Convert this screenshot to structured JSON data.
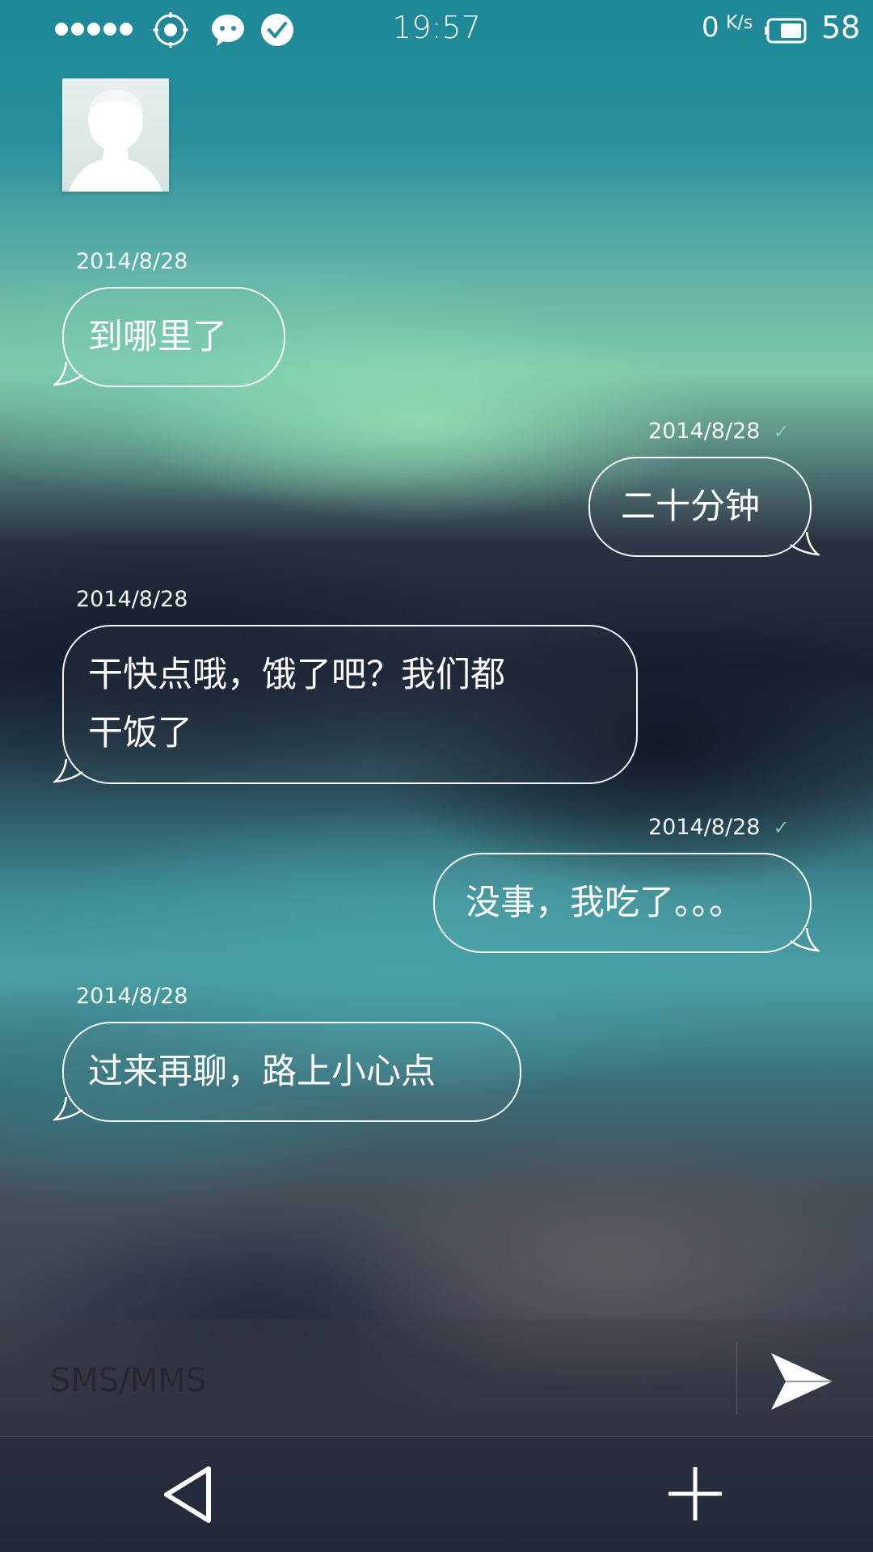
{
  "status_bar": {
    "time": "19:57",
    "net_speed": "0",
    "net_speed_unit": "K/s",
    "battery_level": "58",
    "icons": [
      "signal-dots-icon",
      "location-target-icon",
      "wechat-icon",
      "check-circle-icon",
      "battery-icon"
    ]
  },
  "contact": {
    "avatar_icon": "person-silhouette-icon"
  },
  "messages": [
    {
      "direction": "incoming",
      "timestamp": "2014/8/28",
      "lines": [
        "到哪里了"
      ]
    },
    {
      "direction": "outgoing",
      "timestamp": "2014/8/28",
      "delivered_mark": "✓",
      "lines": [
        "二十分钟"
      ]
    },
    {
      "direction": "incoming",
      "timestamp": "2014/8/28",
      "lines": [
        "干快点哦，饿了吧？我们都",
        "干饭了"
      ]
    },
    {
      "direction": "outgoing",
      "timestamp": "2014/8/28",
      "delivered_mark": "✓",
      "lines": [
        "没事，我吃了。。。"
      ]
    },
    {
      "direction": "incoming",
      "timestamp": "2014/8/28",
      "lines": [
        "过来再聊，路上小心点"
      ]
    }
  ],
  "composer": {
    "placeholder": "SMS/MMS",
    "value": "",
    "send_icon": "send-arrow-icon"
  },
  "nav": {
    "back_icon": "back-triangle-icon",
    "add_icon": "plus-icon"
  }
}
